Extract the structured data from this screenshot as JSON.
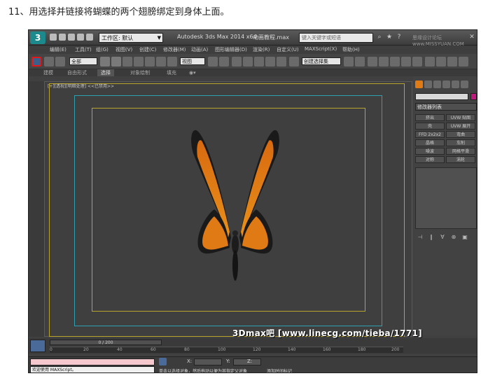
{
  "caption": "11、用选择并链接将蝴蝶的两个翅膀绑定到身体上面。",
  "window": {
    "logo_text": "3",
    "workspace": "工作区: 默认",
    "app_title": "Autodesk 3ds Max  2014 x64",
    "file_name": "动画教程.max",
    "search_placeholder": "键入关键字或短语",
    "watermark_top": "思缘设计论坛 www.MISSYUAN.COM"
  },
  "menu": [
    "编辑(E)",
    "工具(T)",
    "组(G)",
    "视图(V)",
    "创建(C)",
    "修改器(M)",
    "动画(A)",
    "图形编辑器(D)",
    "渲染(R)",
    "自定义(U)",
    "MAXScript(X)",
    "帮助(H)"
  ],
  "toolbar": {
    "filter_value": "全部",
    "view_value": "视图",
    "selection_set_value": "创建选择集"
  },
  "ribbon": {
    "tabs": [
      "建模",
      "自由形式",
      "选择",
      "对象绘制",
      "填充"
    ],
    "active_index": 2
  },
  "viewport": {
    "label": "[+][透视][明暗处理]  <<已禁用>>"
  },
  "command_panel": {
    "modifier_list": "修改器列表",
    "buttons": [
      "挤出",
      "UVW 贴图",
      "壳",
      "UVW 展开",
      "FFD 2x2x2",
      "弯曲",
      "晶格",
      "车削",
      "噪波",
      "网格平滑",
      "对称",
      "涡轮"
    ]
  },
  "timeline": {
    "frame_counter": "0 / 200",
    "ticks": [
      "0",
      "20",
      "40",
      "60",
      "80",
      "100",
      "120",
      "140",
      "160",
      "180",
      "200"
    ]
  },
  "status": {
    "maxscript_prompt": "欢迎使用 MAXScript。",
    "message": "单击以选择对象，然后拖动以便为其指定父对象",
    "add_time_tag": "添加时间标记",
    "x_label": "X:",
    "y_label": "Y:",
    "z_label": "Z:"
  },
  "watermark_bottom": "3Dmax吧  [www.linecg.com/tieba/1771]",
  "colors": {
    "selection_highlight": "#e01818",
    "safe_frame_yellow": "#b8a42a",
    "safe_frame_cyan": "#2ea0b0",
    "color_swatch": "#c0187c"
  }
}
